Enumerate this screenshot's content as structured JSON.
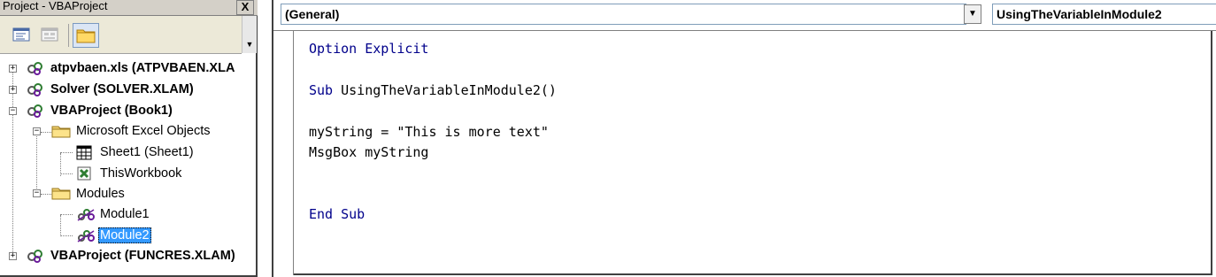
{
  "project_pane": {
    "title": "Project - VBAProject",
    "close_label": "X",
    "toolbar": {
      "view_code_icon": "view-code-icon",
      "view_object_icon": "view-object-icon",
      "toggle_folders_icon": "folder-icon"
    },
    "tree": [
      {
        "label": "atpvbaen.xls (ATPVBAEN.XLA",
        "bold": true,
        "expander": "+",
        "icon": "vba-project-icon"
      },
      {
        "label": "Solver (SOLVER.XLAM)",
        "bold": true,
        "expander": "+",
        "icon": "vba-project-icon"
      },
      {
        "label": "VBAProject (Book1)",
        "bold": true,
        "expander": "-",
        "icon": "vba-project-icon"
      },
      {
        "label": "Microsoft Excel Objects",
        "bold": false,
        "expander": "-",
        "icon": "folder-icon"
      },
      {
        "label": "Sheet1 (Sheet1)",
        "bold": false,
        "icon": "worksheet-icon"
      },
      {
        "label": "ThisWorkbook",
        "bold": false,
        "icon": "workbook-icon"
      },
      {
        "label": "Modules",
        "bold": false,
        "expander": "-",
        "icon": "folder-icon"
      },
      {
        "label": "Module1",
        "bold": false,
        "icon": "module-icon"
      },
      {
        "label": "Module2",
        "bold": false,
        "selected": true,
        "icon": "module-icon"
      },
      {
        "label": "VBAProject (FUNCRES.XLAM)",
        "bold": true,
        "expander": "+",
        "icon": "vba-project-icon"
      }
    ]
  },
  "code_window": {
    "object_combo": "(General)",
    "procedure_combo": "UsingTheVariableInModule2",
    "lines": [
      {
        "kw": "Option Explicit",
        "rest": ""
      },
      {
        "kw": "",
        "rest": ""
      },
      {
        "kw": "Sub",
        "rest": " UsingTheVariableInModule2()"
      },
      {
        "kw": "",
        "rest": ""
      },
      {
        "kw": "",
        "rest": "myString = \"This is more text\""
      },
      {
        "kw": "",
        "rest": "MsgBox myString"
      },
      {
        "kw": "",
        "rest": ""
      },
      {
        "kw": "",
        "rest": ""
      },
      {
        "kw": "End Sub",
        "rest": ""
      }
    ]
  },
  "colors": {
    "keyword": "#00008b",
    "selection": "#3399ff"
  }
}
